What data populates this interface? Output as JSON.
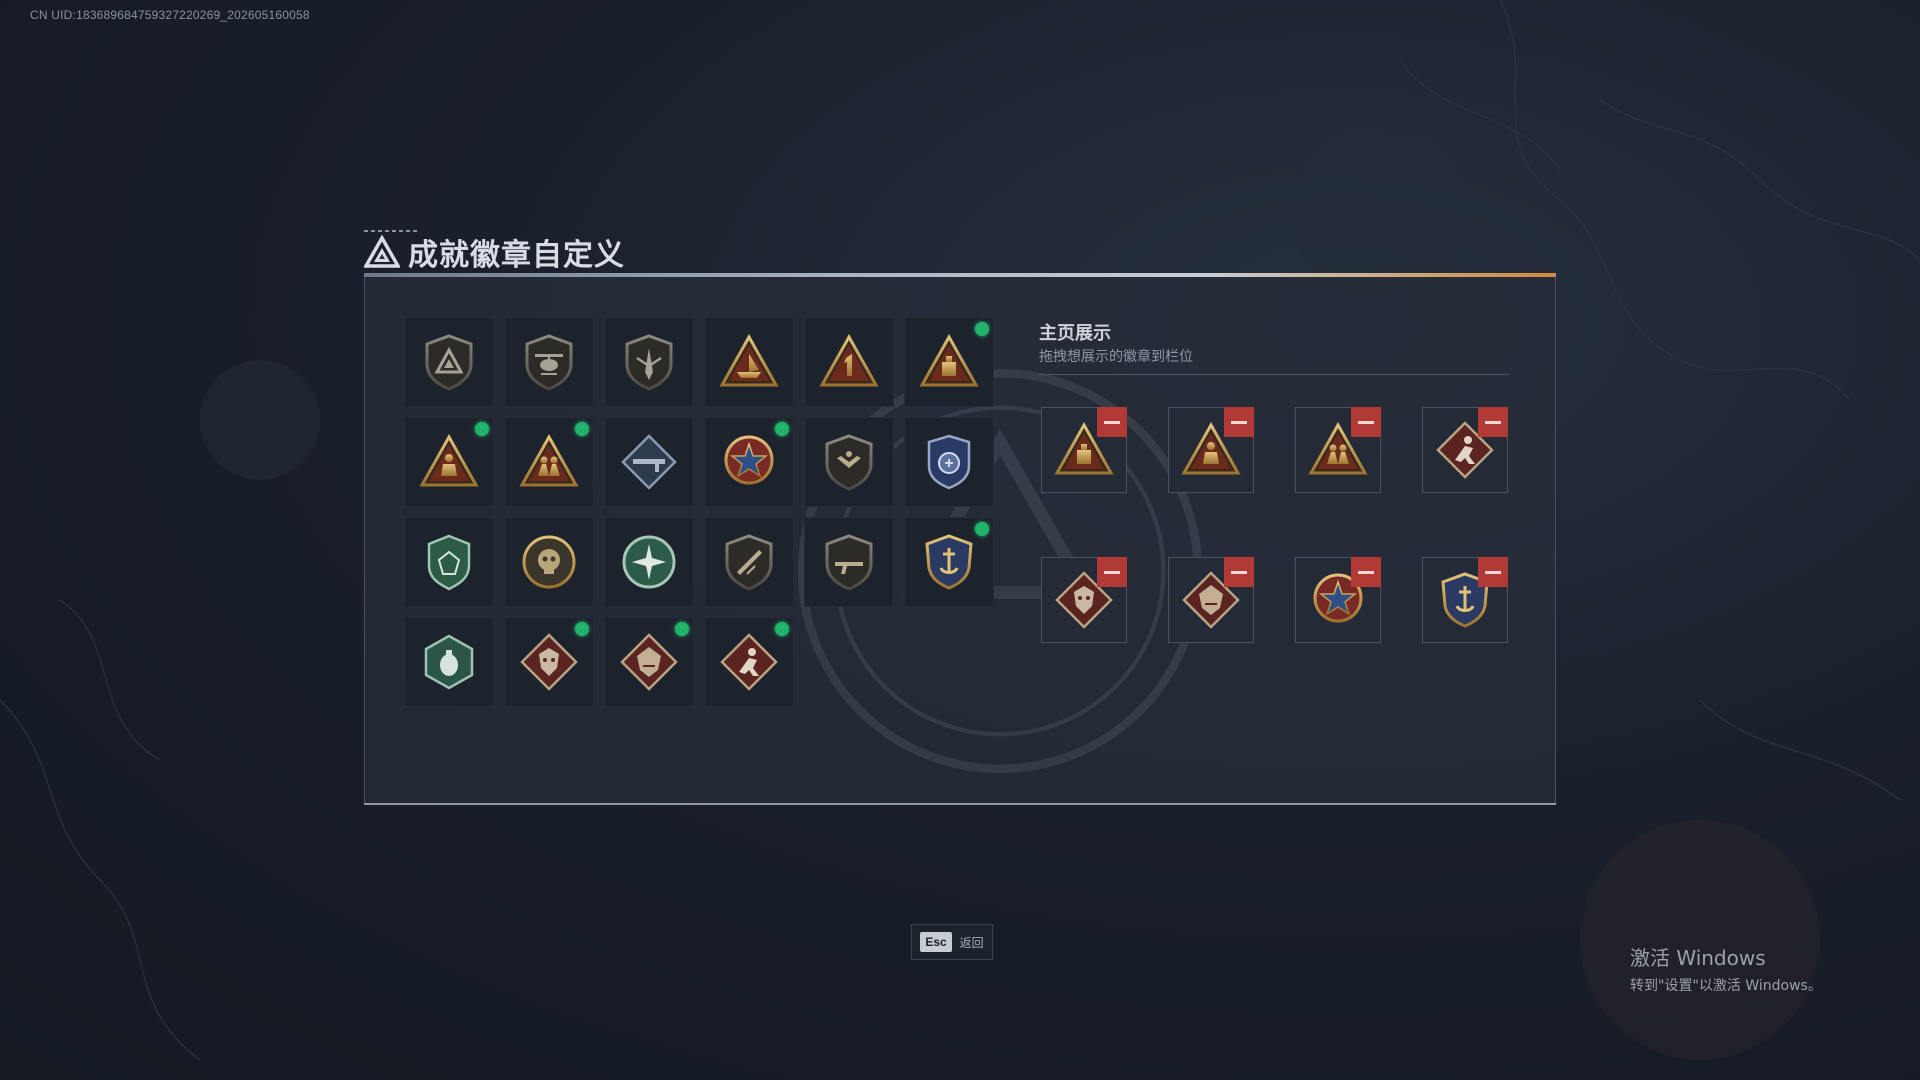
{
  "uid_text": "CN UID:183689684759327220269_202605160058",
  "title": "成就徽章自定义",
  "display": {
    "title": "主页展示",
    "subtitle": "拖拽想展示的徽章到栏位"
  },
  "colors": {
    "accent_green": "#21b36b",
    "remove_red": "#b23a36",
    "gold": "#c9a14e"
  },
  "badges": [
    {
      "icon": "triangle-emblem-shield-badge-icon",
      "new": false
    },
    {
      "icon": "helicopter-shield-badge-icon",
      "new": false
    },
    {
      "icon": "dagger-shield-badge-icon",
      "new": false
    },
    {
      "icon": "ship-triangle-badge-icon",
      "new": false
    },
    {
      "icon": "number-one-triangle-badge-icon",
      "new": false
    },
    {
      "icon": "crate-triangle-badge-icon",
      "new": true
    },
    {
      "icon": "kneeling-soldier-triangle-badge-icon",
      "new": true
    },
    {
      "icon": "soldiers-triangle-badge-icon",
      "new": true
    },
    {
      "icon": "rifle-diamond-badge-icon",
      "new": false
    },
    {
      "icon": "star-medal-badge-icon",
      "new": true
    },
    {
      "icon": "wings-shield-badge-icon",
      "new": false
    },
    {
      "icon": "blue-crest-badge-icon",
      "new": false
    },
    {
      "icon": "green-shield-badge-icon",
      "new": false
    },
    {
      "icon": "skull-round-badge-icon",
      "new": false
    },
    {
      "icon": "green-star-round-badge-icon",
      "new": false
    },
    {
      "icon": "rifle-shield-badge-icon",
      "new": false
    },
    {
      "icon": "rifle-shield-dark-badge-icon",
      "new": false
    },
    {
      "icon": "anchor-crest-badge-icon",
      "new": true
    },
    {
      "icon": "grenade-hexagon-badge-icon",
      "new": false
    },
    {
      "icon": "dragon-diamond-badge-icon",
      "new": true
    },
    {
      "icon": "dragon-diamond-alt-badge-icon",
      "new": true
    },
    {
      "icon": "soldier-diamond-badge-icon",
      "new": true
    }
  ],
  "display_slots": [
    {
      "icon": "crate-triangle-badge-icon"
    },
    {
      "icon": "kneeling-soldier-triangle-badge-icon"
    },
    {
      "icon": "soldiers-triangle-badge-icon"
    },
    {
      "icon": "soldier-diamond-badge-icon"
    },
    {
      "icon": "dragon-diamond-badge-icon"
    },
    {
      "icon": "dragon-diamond-alt-badge-icon"
    },
    {
      "icon": "star-medal-badge-icon"
    },
    {
      "icon": "anchor-crest-badge-icon"
    }
  ],
  "esc": {
    "key": "Esc",
    "label": "返回"
  },
  "activate_windows": {
    "line1": "激活 Windows",
    "line2": "转到\"设置\"以激活 Windows。"
  }
}
